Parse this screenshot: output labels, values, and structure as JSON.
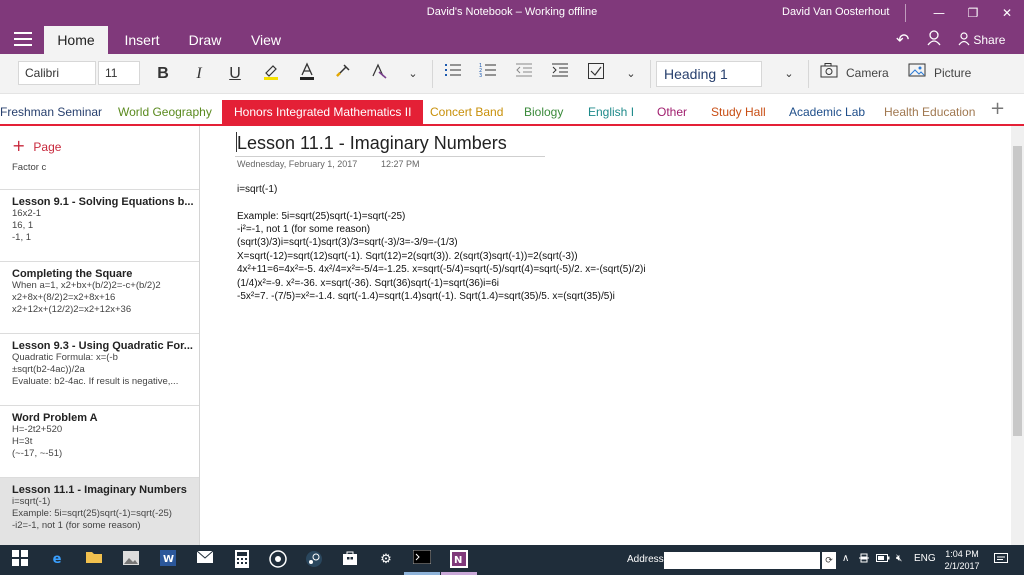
{
  "window": {
    "title": "David's Notebook – Working offline",
    "user": "David Van Oosterhout"
  },
  "ribbon": {
    "tabs": [
      "Home",
      "Insert",
      "Draw",
      "View"
    ],
    "share_label": "Share"
  },
  "toolbar": {
    "font": "Calibri",
    "font_size": "11",
    "bold": "B",
    "italic": "I",
    "underline": "U",
    "style": "Heading 1",
    "camera_label": "Camera",
    "picture_label": "Picture"
  },
  "sections": [
    {
      "label": "Freshman Seminar",
      "color": "#28406e"
    },
    {
      "label": "World Geography",
      "color": "#5a8a1e"
    },
    {
      "label": "Honors Integrated Mathematics II",
      "color": "#ffffff"
    },
    {
      "label": "Concert Band",
      "color": "#c8900a"
    },
    {
      "label": "Biology",
      "color": "#3a8a3a"
    },
    {
      "label": "English I",
      "color": "#1e8a8a"
    },
    {
      "label": "Other",
      "color": "#a01e6e"
    },
    {
      "label": "Study Hall",
      "color": "#c84e14"
    },
    {
      "label": "Academic Lab",
      "color": "#1e4e8a"
    },
    {
      "label": "Health Education",
      "color": "#a07850"
    }
  ],
  "pages": {
    "add_label": "Page",
    "items": [
      {
        "title": "",
        "lines": [
          "Factor c"
        ]
      },
      {
        "title": "Lesson 9.1 - Solving Equations b...",
        "lines": [
          "16x2-1",
          "16, 1",
          "-1, 1"
        ]
      },
      {
        "title": "Completing the Square",
        "lines": [
          "When a=1, x2+bx+(b/2)2=-c+(b/2)2",
          "x2+8x+(8/2)2=x2+8x+16",
          "x2+12x+(12/2)2=x2+12x+36"
        ]
      },
      {
        "title": "Lesson 9.3 - Using Quadratic For...",
        "lines": [
          "Quadratic Formula: x=(-b",
          "±sqrt(b2-4ac))/2a",
          "Evaluate: b2-4ac. If result is negative,..."
        ]
      },
      {
        "title": "Word Problem A",
        "lines": [
          "H=-2t2+520",
          "H=3t",
          "(~-17, ~-51)"
        ]
      },
      {
        "title": "Lesson 11.1 - Imaginary Numbers",
        "lines": [
          "i=sqrt(-1)",
          "Example: 5i=sqrt(25)sqrt(-1)=sqrt(-25)",
          "-i2=-1, not 1 (for some reason)"
        ]
      }
    ]
  },
  "note": {
    "title": "Lesson 11.1 - Imaginary Numbers",
    "date": "Wednesday, February 1, 2017",
    "time": "12:27 PM",
    "lines": [
      "i=sqrt(-1)",
      "",
      "Example: 5i=sqrt(25)sqrt(-1)=sqrt(-25)",
      "-i²=-1, not 1 (for some reason)",
      "(sqrt(3)/3)i=sqrt(-1)sqrt(3)/3=sqrt(-3)/3=-3/9=-(1/3)",
      "X=sqrt(-12)=sqrt(12)sqrt(-1). Sqrt(12)=2(sqrt(3)). 2(sqrt(3)sqrt(-1))=2(sqrt(-3))",
      "4x²+11=6=4x²=-5. 4x²/4=x²=-5/4=-1.25. x=sqrt(-5/4)=sqrt(-5)/sqrt(4)=sqrt(-5)/2. x=-(sqrt(5)/2)i",
      "(1/4)x²=-9. x²=-36. x=sqrt(-36). Sqrt(36)sqrt(-1)=sqrt(36)i=6i",
      "-5x²=7. -(7/5)=x²=-1.4. sqrt(-1.4)=sqrt(1.4)sqrt(-1). Sqrt(1.4)=sqrt(35)/5. x=(sqrt(35)/5)i"
    ]
  },
  "taskbar": {
    "address_label": "Address",
    "lang": "ENG",
    "time": "1:04 PM",
    "date": "2/1/2017"
  }
}
